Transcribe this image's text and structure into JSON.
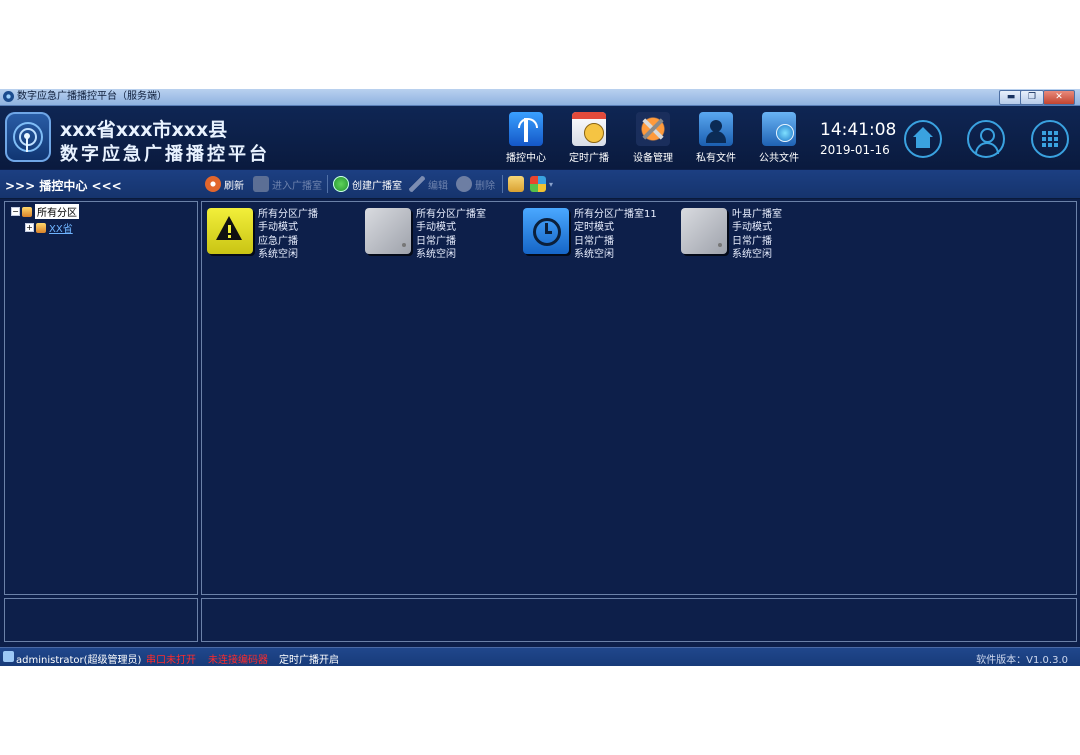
{
  "window": {
    "title": "数字应急广播播控平台（服务端）",
    "minimize": "▬",
    "restore": "❐",
    "close": "✕"
  },
  "header": {
    "title_line1": "xxx省xxx市xxx县",
    "title_line2": "数字应急广播播控平台",
    "nav": [
      {
        "label": "播控中心",
        "icon": "broadcast-tower-icon"
      },
      {
        "label": "定时广播",
        "icon": "calendar-clock-icon"
      },
      {
        "label": "设备管理",
        "icon": "tools-icon"
      },
      {
        "label": "私有文件",
        "icon": "private-folder-icon"
      },
      {
        "label": "公共文件",
        "icon": "public-folder-icon"
      }
    ],
    "time": "14:41:08",
    "date": "2019-01-16",
    "right_icons": [
      "home-icon",
      "user-icon",
      "apps-grid-icon"
    ]
  },
  "toolbar": {
    "panel_title": ">>> 播控中心 <<<",
    "buttons": [
      {
        "label": "刷新",
        "enabled": true
      },
      {
        "label": "进入广播室",
        "enabled": false
      },
      {
        "label": "创建广播室",
        "enabled": true
      },
      {
        "label": "编辑",
        "enabled": false
      },
      {
        "label": "删除",
        "enabled": false
      }
    ]
  },
  "tree": {
    "root": {
      "label": "所有分区",
      "expander": "−"
    },
    "children": [
      {
        "label": "XX省",
        "expander": "+"
      }
    ]
  },
  "rooms": [
    {
      "name": "所有分区广播",
      "mode": "手动模式",
      "type": "应急广播",
      "status": "系统空闲",
      "icon": "warning-icon",
      "color": "#e6e21c"
    },
    {
      "name": "所有分区广播室",
      "mode": "手动模式",
      "type": "日常广播",
      "status": "系统空闲",
      "icon": "gray-panel-icon",
      "color": "#b9bcc4"
    },
    {
      "name": "所有分区广播室11",
      "mode": "定时模式",
      "type": "日常广播",
      "status": "系统空闲",
      "icon": "clock-history-icon",
      "color": "#2f8fe6"
    },
    {
      "name": "叶县广播室",
      "mode": "手动模式",
      "type": "日常广播",
      "status": "系统空闲",
      "icon": "gray-panel-icon",
      "color": "#b9bcc4"
    }
  ],
  "status": {
    "user": "administrator(超级管理员)",
    "serial": "串口未打开",
    "encoder": "未连接编码器",
    "scheduled": "定时广播开启",
    "version": "软件版本：V1.0.3.0",
    "alert_color": "#ff2a2a"
  }
}
